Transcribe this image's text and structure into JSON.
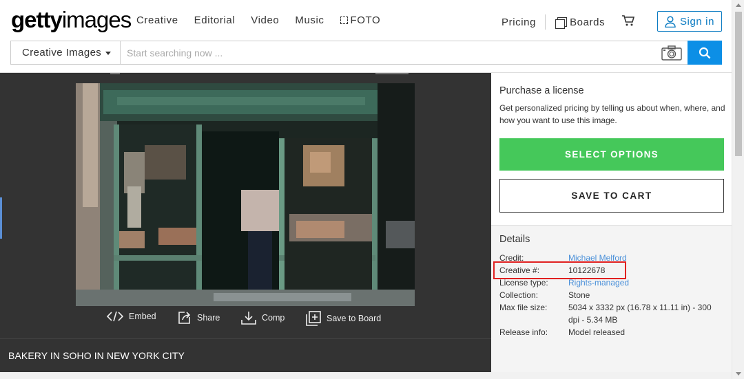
{
  "logo": {
    "bold": "getty",
    "rest": "images"
  },
  "nav": {
    "items": [
      "Creative",
      "Editorial",
      "Video",
      "Music"
    ],
    "foto": "FOTO"
  },
  "header": {
    "pricing": "Pricing",
    "boards": "Boards",
    "signin": "Sign in"
  },
  "search": {
    "type_label": "Creative Images",
    "placeholder": "Start searching now ..."
  },
  "image_actions": {
    "embed": "Embed",
    "share": "Share",
    "comp": "Comp",
    "save_to_board": "Save to Board"
  },
  "caption": "BAKERY IN SOHO IN NEW YORK CITY",
  "purchase": {
    "title": "Purchase a license",
    "description": "Get personalized pricing by telling us about when, where, and how you want to use this image.",
    "select_options": "SELECT OPTIONS",
    "save_to_cart": "SAVE TO CART"
  },
  "details": {
    "title": "Details",
    "rows": [
      {
        "label": "Credit:",
        "value": "Michael Melford"
      },
      {
        "label": "Creative #:",
        "value": "10122678"
      },
      {
        "label": "License type:",
        "value": "Rights-managed"
      },
      {
        "label": "Collection:",
        "value": "Stone"
      },
      {
        "label": "Max file size:",
        "value": "5034 x 3332 px (16.78 x 11.11 in) - 300",
        "value2": "dpi - 5.34 MB"
      },
      {
        "label": "Release info:",
        "value": "Model released"
      }
    ]
  },
  "colors": {
    "accent_blue": "#0c8fe6",
    "select_green": "#45c85a",
    "highlight_red": "#e02020",
    "link_blue": "#4a90d9"
  },
  "icons": [
    "foto-icon",
    "boards-icon",
    "cart-icon",
    "user-icon",
    "camera-icon",
    "search-icon",
    "embed-icon",
    "share-icon",
    "download-icon",
    "add-to-board-icon"
  ]
}
